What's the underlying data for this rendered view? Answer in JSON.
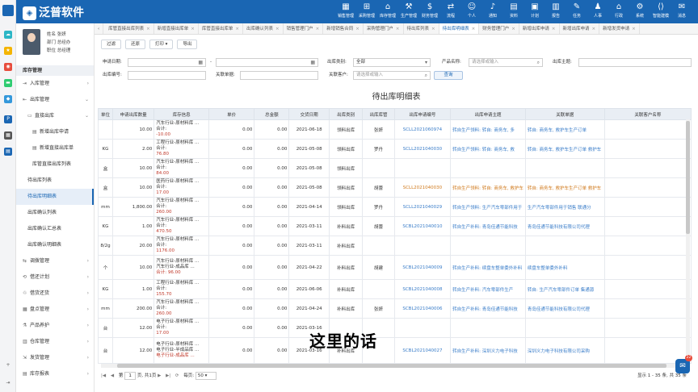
{
  "app": {
    "brand": "泛普软件",
    "logo_caption": "泛普"
  },
  "topnav": [
    {
      "label": "销售管理",
      "icon": "▦"
    },
    {
      "label": "采购管理",
      "icon": "⊞"
    },
    {
      "label": "库存管理",
      "icon": "⌂"
    },
    {
      "label": "生产管理",
      "icon": "⚒"
    },
    {
      "label": "财务管理",
      "icon": "$"
    },
    {
      "label": "流程",
      "icon": "⇄"
    },
    {
      "label": "个人",
      "icon": "☺"
    },
    {
      "label": "通知",
      "icon": "♪"
    },
    {
      "label": "资料",
      "icon": "▤"
    },
    {
      "label": "计划",
      "icon": "▣"
    },
    {
      "label": "报告",
      "icon": "▥"
    },
    {
      "label": "任务",
      "icon": "✎"
    },
    {
      "label": "人事",
      "icon": "♟"
    },
    {
      "label": "行政",
      "icon": "⌂"
    },
    {
      "label": "系统",
      "icon": "⚙"
    },
    {
      "label": "智能建模",
      "icon": "⟨⟩"
    },
    {
      "label": "消息",
      "icon": "✉"
    }
  ],
  "profile": {
    "name": "姓名 张妍",
    "dept": "部门 总经办",
    "title": "职位 总经理"
  },
  "sidebar": {
    "section": "库存管理",
    "items": [
      {
        "label": "入库管理",
        "icon": "⇥"
      },
      {
        "label": "出库管理",
        "icon": "⇤"
      },
      {
        "label": "直接出库",
        "icon": "▭"
      },
      {
        "label": "新增出库申请",
        "icon": "▤"
      },
      {
        "label": "新增直接出库单",
        "icon": "▤"
      },
      {
        "label": "库管直接出库列表",
        "icon": ""
      },
      {
        "label": "待出库列表",
        "icon": ""
      },
      {
        "label": "待出库明细表",
        "icon": ""
      },
      {
        "label": "出库确认列表",
        "icon": ""
      },
      {
        "label": "出库确认汇总表",
        "icon": ""
      },
      {
        "label": "出库确认明细表",
        "icon": ""
      },
      {
        "label": "调拨管理",
        "icon": "⇆"
      },
      {
        "label": "借还计划",
        "icon": "⟲"
      },
      {
        "label": "借货还货",
        "icon": "♲"
      },
      {
        "label": "盘点管理",
        "icon": "▦"
      },
      {
        "label": "产品养护",
        "icon": "⚗"
      },
      {
        "label": "仓库管理",
        "icon": "▥"
      },
      {
        "label": "发货管理",
        "icon": "⇲"
      },
      {
        "label": "库存报表",
        "icon": "▤"
      }
    ]
  },
  "tabs": [
    "库管直接出库列表",
    "新增直接出库单",
    "库管直接出库单",
    "出库确认列表",
    "销售管理门户",
    "新增销售合同",
    "采购管理门户",
    "待出库列表",
    "待出库明细表",
    "财务管理门户",
    "新增出库申请",
    "新增出库申请",
    "新增发货申请"
  ],
  "toolbar": {
    "filter": "过滤",
    "restore": "还原",
    "print": "打印 ▾",
    "export": "导出"
  },
  "filters": {
    "apply_date_label": "申请日期:",
    "date_sep": "-",
    "out_type_label": "出库类别:",
    "out_type_value": "全部",
    "product_name_label": "产品名称:",
    "product_name_placeholder": "请选择或输入",
    "out_theme_label": "出库主题:",
    "out_no_label": "出库编号:",
    "related_doc_label": "关联单据:",
    "related_customer_label": "关联客户:",
    "related_customer_placeholder": "请选择或输入",
    "search_btn": "查询"
  },
  "report_title": "待出库明细表",
  "table": {
    "columns": [
      "单位",
      "申请出库数量",
      "库存信息",
      "单价",
      "总金额",
      "交货日期",
      "出库类别",
      "出库库管",
      "出库申请编号",
      "出库申请主题",
      "关联单据",
      "关联客户名称"
    ],
    "rows": [
      {
        "unit": "",
        "qty": "10.00",
        "inv1": "汽车行业-原材料库 ...",
        "inv2": "合计:",
        "inv3": "-10.00",
        "price": "0.00",
        "amount": "0.00",
        "date": "2021-06-18",
        "type": "领料出库",
        "keeper": "张妍",
        "no": "SCLL2021060974",
        "theme": "转自生产领料: 转自: 商务车, 多",
        "rel": "转自: 商务车, 救护车生产订单",
        "cust": ""
      },
      {
        "unit": "KG",
        "qty": "2.00",
        "inv1": "工程行业-原材料库 ...",
        "inv2": "合计:",
        "inv3": "76.80",
        "price": "0.00",
        "amount": "0.00",
        "date": "2021-05-08",
        "type": "领料出库",
        "keeper": "罗丹",
        "no": "SCLL2021040030",
        "theme": "转自生产领料: 转自: 商务车, 救",
        "rel": "转自: 商务车, 救护车生产订单 救护车",
        "cust": ""
      },
      {
        "unit": "盒",
        "qty": "10.00",
        "inv1": "汽车行业-原材料库 ...",
        "inv2": "合计:",
        "inv3": "84.00",
        "price": "0.00",
        "amount": "0.00",
        "date": "2021-05-08",
        "type": "领料出库",
        "keeper": "",
        "no": "",
        "theme": "",
        "rel": "",
        "cust": ""
      },
      {
        "unit": "盒",
        "qty": "10.00",
        "inv1": "医药行业-原材料库 ...",
        "inv2": "合计:",
        "inv3": "17.00",
        "price": "0.00",
        "amount": "0.00",
        "date": "2021-05-08",
        "type": "领料出库",
        "keeper": "胡蕾",
        "no": "SCLL2021040030",
        "theme": "转自生产领料: 转自: 商务车, 救护车",
        "rel": "转自: 商务车, 救护车生产订单 救护车",
        "cust": ""
      },
      {
        "unit": "mm",
        "qty": "1,800.00",
        "inv1": "汽车行业-原材料库 ...",
        "inv2": "合计:",
        "inv3": "260.00",
        "price": "0.00",
        "amount": "0.00",
        "date": "2021-04-14",
        "type": "领料出库",
        "keeper": "罗丹",
        "no": "SCLL2021040029",
        "theme": "转自生产领料: 生产汽车零部件用于",
        "rel": "生产汽车零部件用于销售 联通分",
        "cust": ""
      },
      {
        "unit": "KG",
        "qty": "1.00",
        "inv1": "汽车行业-原材料库 ...",
        "inv2": "合计:",
        "inv3": "470.50",
        "price": "0.00",
        "amount": "0.00",
        "date": "2021-03-11",
        "type": "补料出库",
        "keeper": "胡蕾",
        "no": "SCBL2021040010",
        "theme": "转自生产补料: 青岛佳通节能科技",
        "rel": "青岛佳通节能科技有限公司代理",
        "cust": ""
      },
      {
        "unit": "8/2g",
        "qty": "20.00",
        "inv1": "汽车行业-原材料库 ...",
        "inv2": "合计:",
        "inv3": "1176.00",
        "price": "0.00",
        "amount": "0.00",
        "date": "2021-03-11",
        "type": "补料出库",
        "keeper": "",
        "no": "",
        "theme": "",
        "rel": "",
        "cust": ""
      },
      {
        "unit": "个",
        "qty": "10.00",
        "inv1": "汽车行业-原材料库 ...",
        "inv2": "汽车行业-成品库 ...",
        "inv3": "合计: 96.00",
        "price": "0.00",
        "amount": "0.00",
        "date": "2021-04-22",
        "type": "补料出库",
        "keeper": "胡建",
        "no": "SCBL2021040009",
        "theme": "转自生产补料: 续盘车整单委外补料",
        "rel": "续盘车整单委外补料",
        "cust": ""
      },
      {
        "unit": "KG",
        "qty": "1.00",
        "inv1": "工程行业-原材料库 ...",
        "inv2": "合计:",
        "inv3": "155.70",
        "price": "0.00",
        "amount": "0.00",
        "date": "2021-06-06",
        "type": "补料出库",
        "keeper": "",
        "no": "SCBL2021040008",
        "theme": "转自生产补料: 汽车零部件生产",
        "rel": "转自: 生产汽车零部件订单 集通源",
        "cust": ""
      },
      {
        "unit": "mm",
        "qty": "200.00",
        "inv1": "汽车行业-原材料库 ...",
        "inv2": "合计:",
        "inv3": "260.00",
        "price": "0.00",
        "amount": "0.00",
        "date": "2021-04-24",
        "type": "补料出库",
        "keeper": "张妍",
        "no": "SCBL2021040006",
        "theme": "转自生产补料: 青岛佳通节能科技",
        "rel": "青岛佳通节能科技有限公司代理",
        "cust": ""
      },
      {
        "unit": "台",
        "qty": "12.00",
        "inv1": "电子行业-原材料库 ...",
        "inv2": "合计:",
        "inv3": "17.00",
        "price": "0.00",
        "amount": "0.00",
        "date": "2021-03-16",
        "type": "",
        "keeper": "",
        "no": "",
        "theme": "",
        "rel": "",
        "cust": ""
      },
      {
        "unit": "台",
        "qty": "12.00",
        "inv1": "电子行业-原材料库 ...",
        "inv2": "电子行业-半成品库 ...",
        "inv3": "电子行业-成品库 ...",
        "price": "0.00",
        "amount": "0.00",
        "date": "2021-03-16",
        "type": "补料出库",
        "keeper": "",
        "no": "SCBL2021040027",
        "theme": "转自生产补料: 深圳义力电子科技",
        "rel": "深圳义力电子科技有限公司采购",
        "cust": ""
      }
    ]
  },
  "pager": {
    "first": "|◀",
    "prev": "◀",
    "page_label": "第",
    "page_value": "1",
    "of_pages": "页, 共1页",
    "next": "▶",
    "last": "▶|",
    "refresh": "⟳",
    "per_page_label": "每页:",
    "per_page_value": "50",
    "summary": "显示 1 - 35 条, 共 35 条"
  },
  "subtitle": "这里的话",
  "chat": {
    "icon": "✉",
    "badge": "22"
  }
}
